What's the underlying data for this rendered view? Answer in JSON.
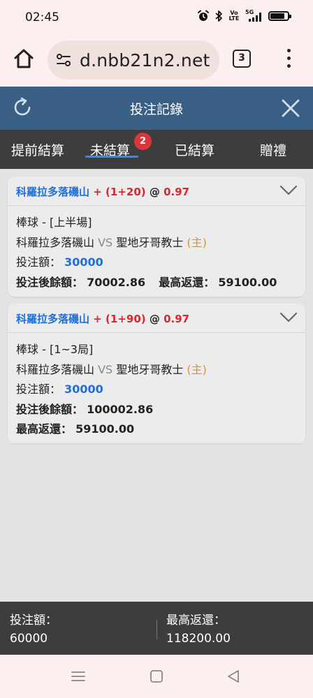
{
  "status_bar": {
    "time": "02:45",
    "icons": [
      "alarm-icon",
      "bluetooth-icon",
      "volte-icon",
      "5g-signal-icon",
      "battery-icon"
    ],
    "volte_text": "Vo LTE",
    "network_text": "5G",
    "battery_level": 0.85
  },
  "browser": {
    "url": "d.nbb21n2.net",
    "tab_count": "3"
  },
  "header": {
    "title": "投注記錄"
  },
  "tabs": [
    {
      "label": "提前結算",
      "active": false
    },
    {
      "label": "未結算",
      "active": true,
      "badge": "2"
    },
    {
      "label": "已結算",
      "active": false
    },
    {
      "label": "贈禮",
      "active": false
    }
  ],
  "bets": [
    {
      "team": "科羅拉多落磯山",
      "handicap": "+ (1+20)",
      "at": "@",
      "odds": "0.97",
      "market": "棒球 - [上半場]",
      "home_team": "科羅拉多落磯山",
      "vs": "VS",
      "away_team": "聖地牙哥教士",
      "side": "(主)",
      "stake_label": "投注額：",
      "stake": "30000",
      "balance_label": "投注後餘額：",
      "balance": "70002.86",
      "max_return_label": "最高返還：",
      "max_return": "59100.00"
    },
    {
      "team": "科羅拉多落磯山",
      "handicap": "+ (1+90)",
      "at": "@",
      "odds": "0.97",
      "market": "棒球 - [1~3局]",
      "home_team": "科羅拉多落磯山",
      "vs": "VS",
      "away_team": "聖地牙哥教士",
      "side": "(主)",
      "stake_label": "投注額：",
      "stake": "30000",
      "balance_label": "投注後餘額：",
      "balance": "100002.86",
      "max_return_label": "最高返還：",
      "max_return": "59100.00"
    }
  ],
  "summary": {
    "stake_label": "投注額：",
    "stake_total": "60000",
    "max_return_label": "最高返還：",
    "max_return_total": "118200.00"
  },
  "colors": {
    "header_bg": "#3a5f84",
    "tabs_bg": "#3d3d3d",
    "accent_blue": "#1f6fd6",
    "odds_red": "#d9262f",
    "home_orange": "#e0902a",
    "badge_red": "#d9363e"
  },
  "nav": [
    "menu-icon",
    "home-square-icon",
    "back-triangle-icon"
  ]
}
